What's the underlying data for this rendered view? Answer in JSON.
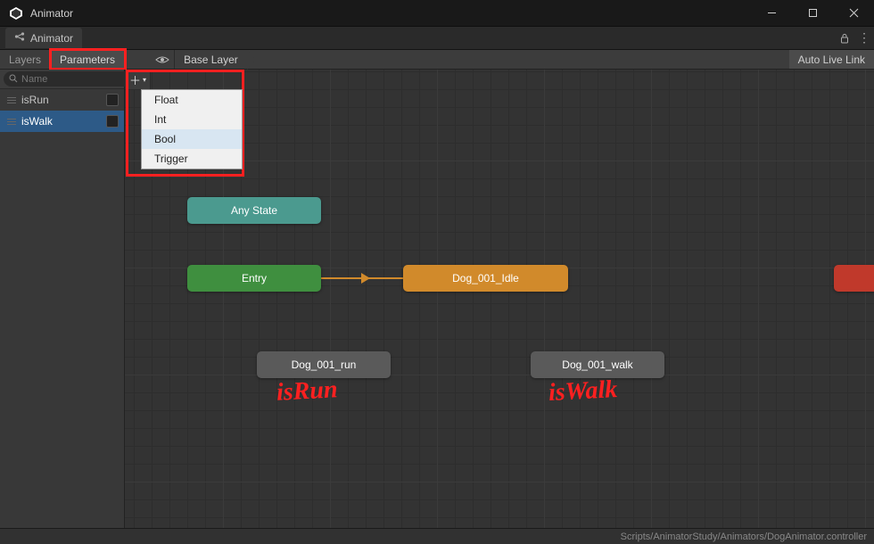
{
  "window": {
    "title": "Animator"
  },
  "tabbar": {
    "animator": "Animator"
  },
  "subheader": {
    "layers": "Layers",
    "parameters": "Parameters",
    "breadcrumb": "Base Layer",
    "autolive": "Auto Live Link"
  },
  "sidebar": {
    "search_placeholder": "Name",
    "params": [
      {
        "name": "isRun",
        "selected": false
      },
      {
        "name": "isWalk",
        "selected": true
      }
    ]
  },
  "add_param_menu": {
    "items": [
      "Float",
      "Int",
      "Bool",
      "Trigger"
    ],
    "hover_index": 2
  },
  "canvas": {
    "any_state": "Any State",
    "entry": "Entry",
    "default_state": "Dog_001_Idle",
    "run_state": "Dog_001_run",
    "walk_state": "Dog_001_walk"
  },
  "annotations": {
    "run": "isRun",
    "walk": "isWalk"
  },
  "statusbar": {
    "path": "Scripts/AnimatorStudy/Animators/DogAnimator.controller"
  }
}
